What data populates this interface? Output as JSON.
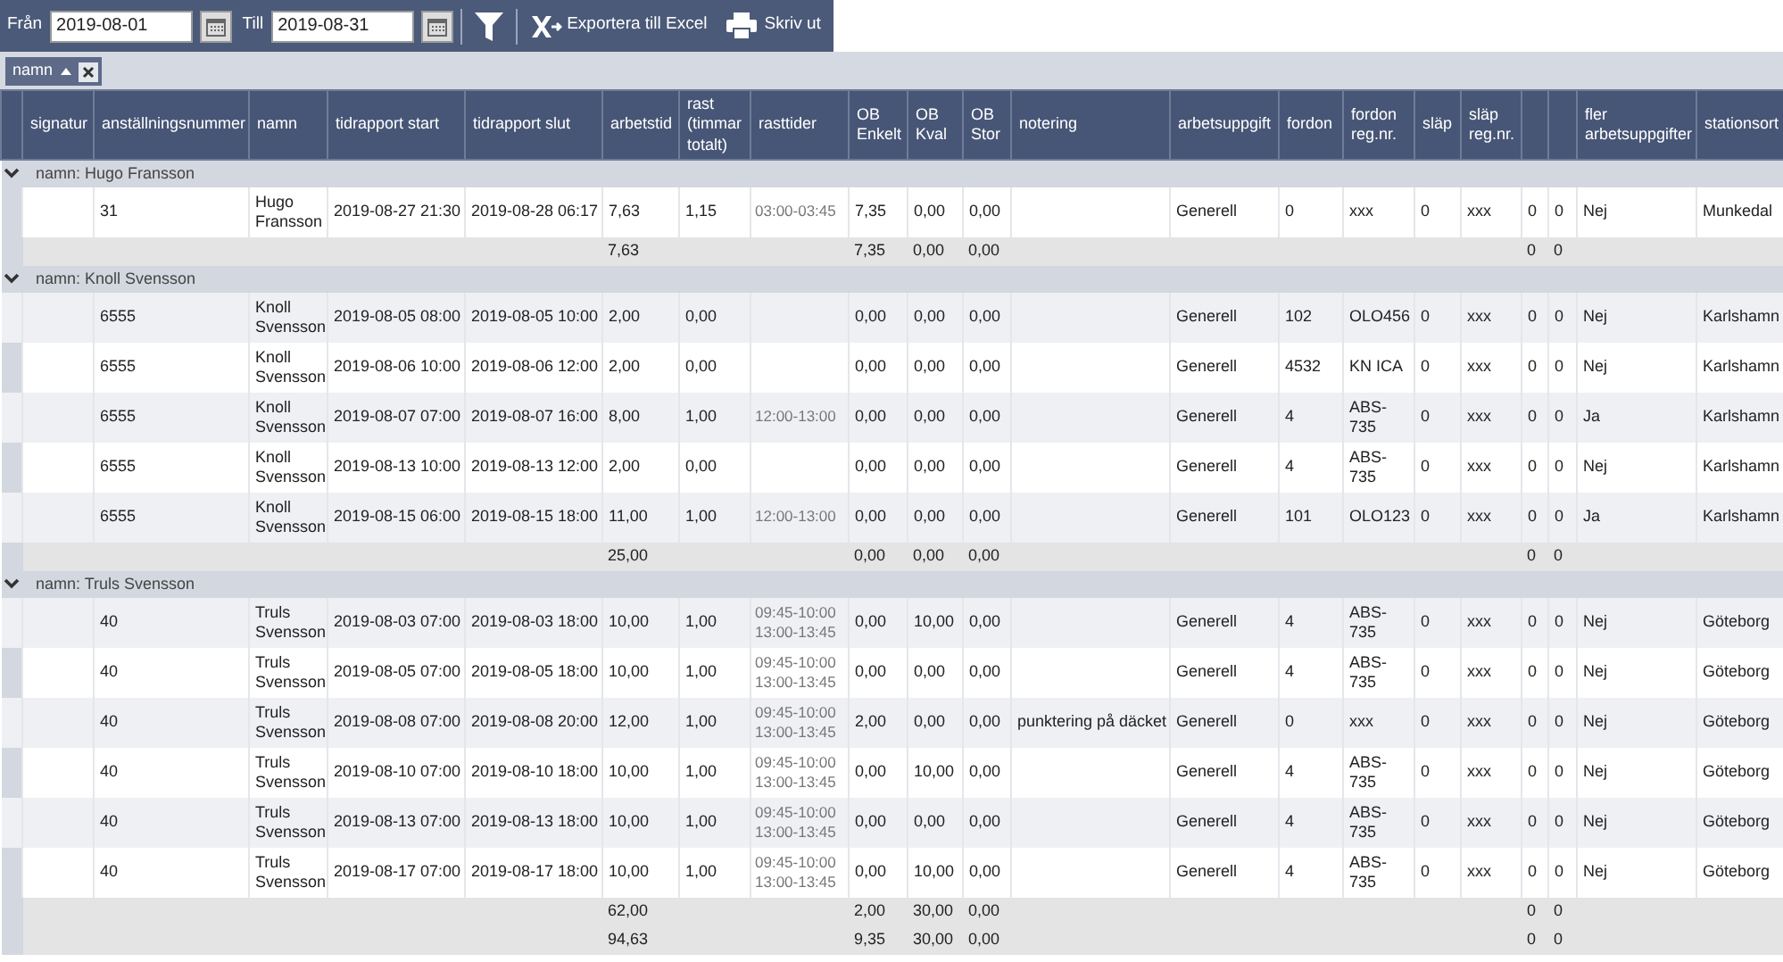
{
  "toolbar": {
    "from_label": "Från",
    "from_value": "2019-08-01",
    "to_label": "Till",
    "to_value": "2019-08-31",
    "export_label": "Exportera till Excel",
    "print_label": "Skriv ut"
  },
  "group_chip": {
    "label": "namn",
    "sorted_ascending": true
  },
  "columns": [
    {
      "label": "signatur"
    },
    {
      "label": "anställningsnummer"
    },
    {
      "label": "namn"
    },
    {
      "label": "tidrapport start"
    },
    {
      "label": "tidrapport slut"
    },
    {
      "label": "arbetstid"
    },
    {
      "label": "rast (timmar totalt)"
    },
    {
      "label": "rasttider"
    },
    {
      "label": "OB Enkelt"
    },
    {
      "label": "OB Kval"
    },
    {
      "label": "OB Stor"
    },
    {
      "label": "notering"
    },
    {
      "label": "arbetsuppgift"
    },
    {
      "label": "fordon"
    },
    {
      "label": "fordon reg.nr."
    },
    {
      "label": "släp"
    },
    {
      "label": "släp reg.nr."
    },
    {},
    {},
    {
      "label": "fler arbetsuppgifter"
    },
    {
      "label": "stationsort"
    }
  ],
  "groups": [
    {
      "label": "namn: Hugo Fransson",
      "expanded": true,
      "rows": [
        [
          {},
          {
            "text": "31"
          },
          {
            "text": "Hugo Fransson"
          },
          {
            "text": "2019-08-27 21:30"
          },
          {
            "text": "2019-08-28 06:17"
          },
          {
            "text": "7,63"
          },
          {
            "text": "1,15"
          },
          {
            "text": "03:00-03:45"
          },
          {
            "text": "7,35"
          },
          {
            "text": "0,00"
          },
          {
            "text": "0,00"
          },
          {},
          {
            "text": "Generell"
          },
          {
            "text": "0"
          },
          {
            "text": "xxx"
          },
          {
            "text": "0"
          },
          {
            "text": "xxx"
          },
          {
            "text": "0"
          },
          {
            "text": "0"
          },
          {
            "text": "Nej"
          },
          {
            "text": "Munkedal"
          }
        ]
      ],
      "summary": {
        "arbetstid": "7,63",
        "ob_enkelt": "7,35",
        "ob_kval": "0,00",
        "ob_stor": "0,00",
        "column_18": "0",
        "column_19": "0"
      }
    },
    {
      "label": "namn: Knoll Svensson",
      "expanded": true,
      "rows": [
        [
          {},
          {
            "text": "6555"
          },
          {
            "text": "Knoll Svensson"
          },
          {
            "text": "2019-08-05 08:00"
          },
          {
            "text": "2019-08-05 10:00"
          },
          {
            "text": "2,00"
          },
          {
            "text": "0,00"
          },
          {},
          {
            "text": "0,00"
          },
          {
            "text": "0,00"
          },
          {
            "text": "0,00"
          },
          {},
          {
            "text": "Generell"
          },
          {
            "text": "102"
          },
          {
            "text": "OLO456"
          },
          {
            "text": "0"
          },
          {
            "text": "xxx"
          },
          {
            "text": "0"
          },
          {
            "text": "0"
          },
          {
            "text": "Nej"
          },
          {
            "text": "Karlshamn"
          }
        ],
        [
          {},
          {
            "text": "6555"
          },
          {
            "text": "Knoll Svensson"
          },
          {
            "text": "2019-08-06 10:00"
          },
          {
            "text": "2019-08-06 12:00"
          },
          {
            "text": "2,00"
          },
          {
            "text": "0,00"
          },
          {},
          {
            "text": "0,00"
          },
          {
            "text": "0,00"
          },
          {
            "text": "0,00"
          },
          {},
          {
            "text": "Generell"
          },
          {
            "text": "4532"
          },
          {
            "text": "KN ICA"
          },
          {
            "text": "0"
          },
          {
            "text": "xxx"
          },
          {
            "text": "0"
          },
          {
            "text": "0"
          },
          {
            "text": "Nej"
          },
          {
            "text": "Karlshamn"
          }
        ],
        [
          {},
          {
            "text": "6555"
          },
          {
            "text": "Knoll Svensson"
          },
          {
            "text": "2019-08-07 07:00"
          },
          {
            "text": "2019-08-07 16:00"
          },
          {
            "text": "8,00"
          },
          {
            "text": "1,00"
          },
          {
            "text": "12:00-13:00"
          },
          {
            "text": "0,00"
          },
          {
            "text": "0,00"
          },
          {
            "text": "0,00"
          },
          {},
          {
            "text": "Generell"
          },
          {
            "text": "4"
          },
          {
            "text": "ABS-735"
          },
          {
            "text": "0"
          },
          {
            "text": "xxx"
          },
          {
            "text": "0"
          },
          {
            "text": "0"
          },
          {
            "text": "Ja"
          },
          {
            "text": "Karlshamn"
          }
        ],
        [
          {},
          {
            "text": "6555"
          },
          {
            "text": "Knoll Svensson"
          },
          {
            "text": "2019-08-13 10:00"
          },
          {
            "text": "2019-08-13 12:00"
          },
          {
            "text": "2,00"
          },
          {
            "text": "0,00"
          },
          {},
          {
            "text": "0,00"
          },
          {
            "text": "0,00"
          },
          {
            "text": "0,00"
          },
          {},
          {
            "text": "Generell"
          },
          {
            "text": "4"
          },
          {
            "text": "ABS-735"
          },
          {
            "text": "0"
          },
          {
            "text": "xxx"
          },
          {
            "text": "0"
          },
          {
            "text": "0"
          },
          {
            "text": "Nej"
          },
          {
            "text": "Karlshamn"
          }
        ],
        [
          {},
          {
            "text": "6555"
          },
          {
            "text": "Knoll Svensson"
          },
          {
            "text": "2019-08-15 06:00"
          },
          {
            "text": "2019-08-15 18:00"
          },
          {
            "text": "11,00"
          },
          {
            "text": "1,00"
          },
          {
            "text": "12:00-13:00"
          },
          {
            "text": "0,00"
          },
          {
            "text": "0,00"
          },
          {
            "text": "0,00"
          },
          {},
          {
            "text": "Generell"
          },
          {
            "text": "101"
          },
          {
            "text": "OLO123"
          },
          {
            "text": "0"
          },
          {
            "text": "xxx"
          },
          {
            "text": "0"
          },
          {
            "text": "0"
          },
          {
            "text": "Ja"
          },
          {
            "text": "Karlshamn"
          }
        ]
      ],
      "summary": {
        "arbetstid": "25,00",
        "ob_enkelt": "0,00",
        "ob_kval": "0,00",
        "ob_stor": "0,00",
        "column_18": "0",
        "column_19": "0"
      }
    },
    {
      "label": "namn: Truls Svensson",
      "expanded": true,
      "rows": [
        [
          {},
          {
            "text": "40"
          },
          {
            "text": "Truls Svensson"
          },
          {
            "text": "2019-08-03 07:00"
          },
          {
            "text": "2019-08-03 18:00"
          },
          {
            "text": "10,00"
          },
          {
            "text": "1,00"
          },
          {
            "text": "09:45-10:00\n13:00-13:45"
          },
          {
            "text": "0,00"
          },
          {
            "text": "10,00"
          },
          {
            "text": "0,00"
          },
          {},
          {
            "text": "Generell"
          },
          {
            "text": "4"
          },
          {
            "text": "ABS-735"
          },
          {
            "text": "0"
          },
          {
            "text": "xxx"
          },
          {
            "text": "0"
          },
          {
            "text": "0"
          },
          {
            "text": "Nej"
          },
          {
            "text": "Göteborg"
          }
        ],
        [
          {},
          {
            "text": "40"
          },
          {
            "text": "Truls Svensson"
          },
          {
            "text": "2019-08-05 07:00"
          },
          {
            "text": "2019-08-05 18:00"
          },
          {
            "text": "10,00"
          },
          {
            "text": "1,00"
          },
          {
            "text": "09:45-10:00\n13:00-13:45"
          },
          {
            "text": "0,00"
          },
          {
            "text": "0,00"
          },
          {
            "text": "0,00"
          },
          {},
          {
            "text": "Generell"
          },
          {
            "text": "4"
          },
          {
            "text": "ABS-735"
          },
          {
            "text": "0"
          },
          {
            "text": "xxx"
          },
          {
            "text": "0"
          },
          {
            "text": "0"
          },
          {
            "text": "Nej"
          },
          {
            "text": "Göteborg"
          }
        ],
        [
          {},
          {
            "text": "40"
          },
          {
            "text": "Truls Svensson"
          },
          {
            "text": "2019-08-08 07:00"
          },
          {
            "text": "2019-08-08 20:00"
          },
          {
            "text": "12,00"
          },
          {
            "text": "1,00"
          },
          {
            "text": "09:45-10:00\n13:00-13:45"
          },
          {
            "text": "2,00"
          },
          {
            "text": "0,00"
          },
          {
            "text": "0,00"
          },
          {
            "text": "punktering på däcket"
          },
          {
            "text": "Generell"
          },
          {
            "text": "0"
          },
          {
            "text": "xxx"
          },
          {
            "text": "0"
          },
          {
            "text": "xxx"
          },
          {
            "text": "0"
          },
          {
            "text": "0"
          },
          {
            "text": "Nej"
          },
          {
            "text": "Göteborg"
          }
        ],
        [
          {},
          {
            "text": "40"
          },
          {
            "text": "Truls Svensson"
          },
          {
            "text": "2019-08-10 07:00"
          },
          {
            "text": "2019-08-10 18:00"
          },
          {
            "text": "10,00"
          },
          {
            "text": "1,00"
          },
          {
            "text": "09:45-10:00\n13:00-13:45"
          },
          {
            "text": "0,00"
          },
          {
            "text": "10,00"
          },
          {
            "text": "0,00"
          },
          {},
          {
            "text": "Generell"
          },
          {
            "text": "4"
          },
          {
            "text": "ABS-735"
          },
          {
            "text": "0"
          },
          {
            "text": "xxx"
          },
          {
            "text": "0"
          },
          {
            "text": "0"
          },
          {
            "text": "Nej"
          },
          {
            "text": "Göteborg"
          }
        ],
        [
          {},
          {
            "text": "40"
          },
          {
            "text": "Truls Svensson"
          },
          {
            "text": "2019-08-13 07:00"
          },
          {
            "text": "2019-08-13 18:00"
          },
          {
            "text": "10,00"
          },
          {
            "text": "1,00"
          },
          {
            "text": "09:45-10:00\n13:00-13:45"
          },
          {
            "text": "0,00"
          },
          {
            "text": "0,00"
          },
          {
            "text": "0,00"
          },
          {},
          {
            "text": "Generell"
          },
          {
            "text": "4"
          },
          {
            "text": "ABS-735"
          },
          {
            "text": "0"
          },
          {
            "text": "xxx"
          },
          {
            "text": "0"
          },
          {
            "text": "0"
          },
          {
            "text": "Nej"
          },
          {
            "text": "Göteborg"
          }
        ],
        [
          {},
          {
            "text": "40"
          },
          {
            "text": "Truls Svensson"
          },
          {
            "text": "2019-08-17 07:00"
          },
          {
            "text": "2019-08-17 18:00"
          },
          {
            "text": "10,00"
          },
          {
            "text": "1,00"
          },
          {
            "text": "09:45-10:00\n13:00-13:45"
          },
          {
            "text": "0,00"
          },
          {
            "text": "10,00"
          },
          {
            "text": "0,00"
          },
          {},
          {
            "text": "Generell"
          },
          {
            "text": "4"
          },
          {
            "text": "ABS-735"
          },
          {
            "text": "0"
          },
          {
            "text": "xxx"
          },
          {
            "text": "0"
          },
          {
            "text": "0"
          },
          {
            "text": "Nej"
          },
          {
            "text": "Göteborg"
          }
        ]
      ],
      "summary": {
        "arbetstid": "62,00",
        "ob_enkelt": "2,00",
        "ob_kval": "30,00",
        "ob_stor": "0,00",
        "column_18": "0",
        "column_19": "0"
      }
    }
  ],
  "grand_total": {
    "arbetstid": "94,63",
    "ob_enkelt": "9,35",
    "ob_kval": "30,00",
    "ob_stor": "0,00",
    "column_18": "0",
    "column_19": "0"
  }
}
